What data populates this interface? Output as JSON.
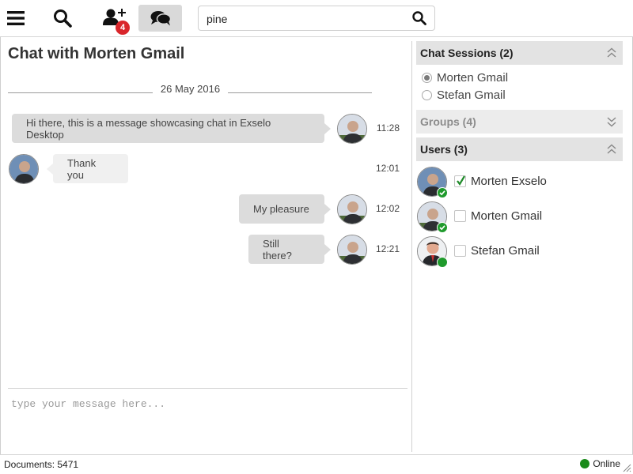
{
  "toolbar": {
    "notification_count": "4",
    "search_value": "pine"
  },
  "chat": {
    "title": "Chat with Morten Gmail",
    "date": "26 May 2016",
    "messages": [
      {
        "text": "Hi there, this is a message showcasing chat in Exselo Desktop",
        "time": "11:28",
        "direction": "out"
      },
      {
        "text": "Thank you",
        "time": "12:01",
        "direction": "in"
      },
      {
        "text": "My pleasure",
        "time": "12:02",
        "direction": "out"
      },
      {
        "text": "Still there?",
        "time": "12:21",
        "direction": "out"
      }
    ],
    "input_placeholder": "type your message here..."
  },
  "sidebar": {
    "chat_sessions": {
      "title": "Chat Sessions (2)",
      "items": [
        {
          "label": "Morten Gmail",
          "selected": true
        },
        {
          "label": "Stefan Gmail",
          "selected": false
        }
      ]
    },
    "groups": {
      "title": "Groups (4)"
    },
    "users": {
      "title": "Users (3)",
      "items": [
        {
          "name": "Morten Exselo",
          "checked": true,
          "presence": "online-check"
        },
        {
          "name": "Morten Gmail",
          "checked": false,
          "presence": "online-check"
        },
        {
          "name": "Stefan Gmail",
          "checked": false,
          "presence": "online"
        }
      ]
    }
  },
  "status": {
    "documents": "Documents: 5471",
    "online": "Online"
  },
  "colors": {
    "online_green": "#1f9a2c",
    "badge_red": "#d9262b",
    "bubble_out": "#dcdcdc",
    "bubble_in": "#f0f0f0"
  }
}
